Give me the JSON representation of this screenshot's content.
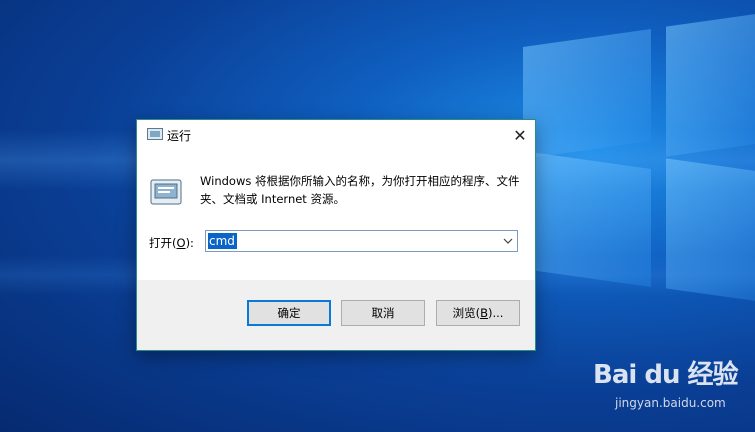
{
  "dialog": {
    "title": "运行",
    "close_glyph": "✕",
    "description": "Windows 将根据你所输入的名称，为你打开相应的程序、文件夹、文档或 Internet 资源。",
    "open_label_prefix": "打开(",
    "open_label_key": "O",
    "open_label_suffix": "):",
    "open_value": "cmd",
    "buttons": {
      "ok_label": "确定",
      "cancel_label": "取消",
      "browse_prefix": "浏览(",
      "browse_key": "B",
      "browse_suffix": ")..."
    }
  },
  "watermark": {
    "brand": "Bai du 经验",
    "url": "jingyan.baidu.com"
  },
  "icons": {
    "title": "run-app-icon",
    "main": "run-app-icon",
    "combo": "chevron-down-icon",
    "close": "close-icon"
  },
  "colors": {
    "accent": "#0a78d7",
    "selection": "#0a64c8",
    "desktop": "#0a4aa8"
  }
}
